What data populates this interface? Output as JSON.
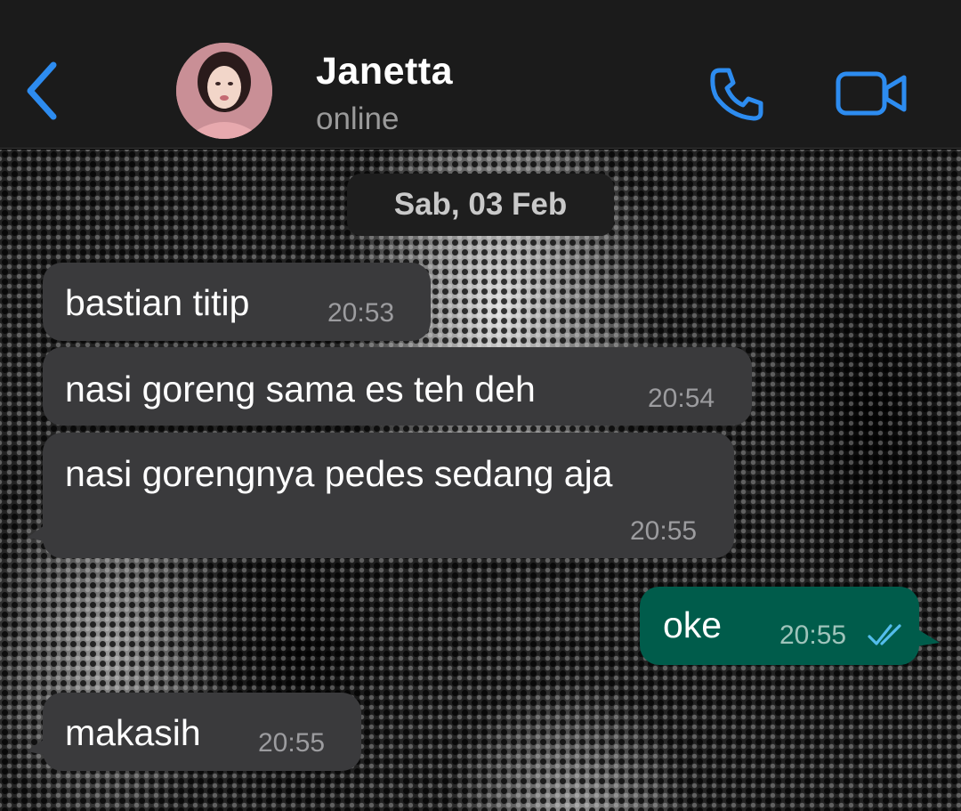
{
  "header": {
    "contact_name": "Janetta",
    "contact_status": "online",
    "back_icon": "chevron-left-icon",
    "call_icon": "phone-icon",
    "video_icon": "video-camera-icon",
    "accent_color": "#2d8cf0"
  },
  "chat": {
    "date_label": "Sab, 03 Feb",
    "messages": [
      {
        "direction": "incoming",
        "text": "bastian titip",
        "time": "20:53"
      },
      {
        "direction": "incoming",
        "text": "nasi goreng sama es teh deh",
        "time": "20:54"
      },
      {
        "direction": "incoming",
        "text": "nasi gorengnya pedes sedang aja",
        "time": "20:55"
      },
      {
        "direction": "outgoing",
        "text": "oke",
        "time": "20:55",
        "status": "read",
        "status_icon": "double-check-icon"
      },
      {
        "direction": "incoming",
        "text": "makasih",
        "time": "20:55"
      }
    ]
  },
  "colors": {
    "header_bg": "#1b1b1b",
    "incoming_bubble": "#3a3a3c",
    "outgoing_bubble": "#005c4b",
    "read_tick": "#53bdeb"
  }
}
